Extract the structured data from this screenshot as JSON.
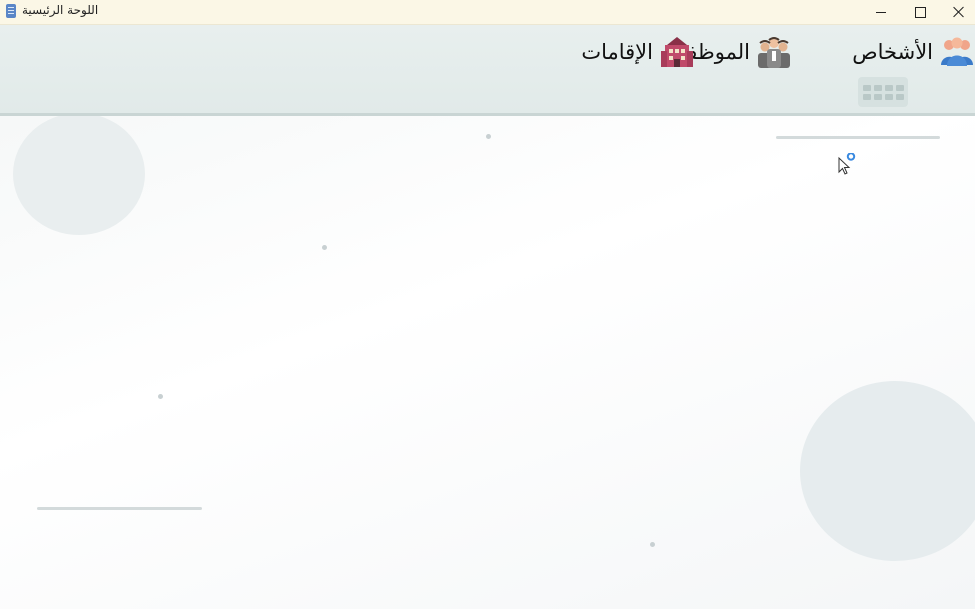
{
  "window": {
    "title": "اللوحة الرئيسية"
  },
  "nav": {
    "persons_label": "الأشخاص",
    "employees_label": "الموظفين",
    "residences_label": "الإقامات"
  },
  "icons": {
    "persons": "people-group-icon",
    "employees": "employees-icon",
    "residences": "building-icon",
    "grid": "apps-grid-icon"
  },
  "colors": {
    "titlebar": "#fbf7e6",
    "header": "#e4ecec",
    "accent_blue": "#3a7ac9",
    "building_pink": "#c04a6a"
  }
}
